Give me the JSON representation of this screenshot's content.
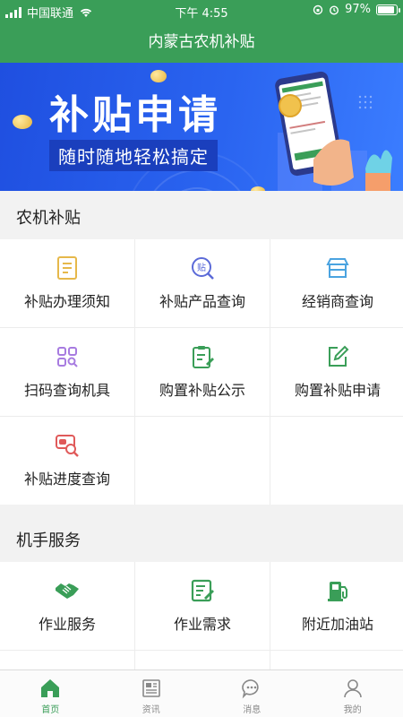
{
  "status_bar": {
    "carrier": "中国联通",
    "time": "下午 4:55",
    "battery": "97%",
    "battery_level": 0.97
  },
  "nav": {
    "title": "内蒙古农机补贴"
  },
  "banner": {
    "title": "补贴申请",
    "subtitle": "随时随地轻松搞定"
  },
  "sections": [
    {
      "title": "农机补贴",
      "items": [
        {
          "label": "补贴办理须知",
          "icon": "document-list-icon",
          "color": "#e6b84a"
        },
        {
          "label": "补贴产品查询",
          "icon": "subsidy-search-icon",
          "color": "#5b6ad8"
        },
        {
          "label": "经销商查询",
          "icon": "store-icon",
          "color": "#4aa3e0"
        },
        {
          "label": "扫码查询机具",
          "icon": "scan-grid-icon",
          "color": "#a77be0"
        },
        {
          "label": "购置补贴公示",
          "icon": "clipboard-edit-icon",
          "color": "#3a9e58"
        },
        {
          "label": "购置补贴申请",
          "icon": "edit-square-icon",
          "color": "#3a9e58"
        },
        {
          "label": "补贴进度查询",
          "icon": "progress-search-icon",
          "color": "#e05a5a"
        }
      ]
    },
    {
      "title": "机手服务",
      "items": [
        {
          "label": "作业服务",
          "icon": "handshake-icon",
          "color": "#3a9e58"
        },
        {
          "label": "作业需求",
          "icon": "clipboard-pen-icon",
          "color": "#3a9e58"
        },
        {
          "label": "附近加油站",
          "icon": "fuel-pump-icon",
          "color": "#3a9e58"
        }
      ]
    }
  ],
  "tabs": [
    {
      "label": "首页",
      "icon": "home-icon",
      "active": true
    },
    {
      "label": "资讯",
      "icon": "news-icon",
      "active": false
    },
    {
      "label": "消息",
      "icon": "message-icon",
      "active": false
    },
    {
      "label": "我的",
      "icon": "user-icon",
      "active": false
    }
  ],
  "colors": {
    "primary": "#3a9e58",
    "banner": "#2a64f0"
  }
}
